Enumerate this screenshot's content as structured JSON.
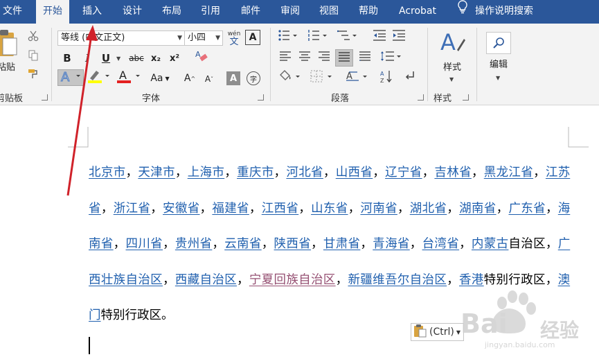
{
  "tabs": {
    "file": "文件",
    "home": "开始",
    "insert": "插入",
    "design": "设计",
    "layout": "布局",
    "references": "引用",
    "mailings": "邮件",
    "review": "审阅",
    "view": "视图",
    "help": "帮助",
    "acrobat": "Acrobat",
    "tell_me": "操作说明搜索"
  },
  "ribbon": {
    "clipboard": {
      "paste_label": "粘贴",
      "group_label": "剪贴板"
    },
    "font": {
      "font_name": "等线 (中文正文)",
      "font_size": "小四",
      "group_label": "字体",
      "bold": "B",
      "italic": "I",
      "underline": "U",
      "strike": "abc",
      "subscript": "x₂",
      "superscript": "x²",
      "font_color": "A",
      "change_case": "Aa",
      "grow": "A",
      "shrink": "A",
      "wen": "wén",
      "wen_char": "文",
      "border_char": "A",
      "shade_char": "A",
      "enclose_char": "字"
    },
    "paragraph": {
      "group_label": "段落"
    },
    "styles": {
      "label": "样式",
      "group_label": "样式"
    },
    "editing": {
      "label": "编辑"
    }
  },
  "document": {
    "paste_options": "(Ctrl)",
    "text_segments": [
      {
        "t": "北京市",
        "link": true
      },
      {
        "t": "，",
        "link": false
      },
      {
        "t": "天津市",
        "link": true
      },
      {
        "t": "，",
        "link": false
      },
      {
        "t": "上海市",
        "link": true
      },
      {
        "t": "，",
        "link": false
      },
      {
        "t": "重庆市",
        "link": true
      },
      {
        "t": "，",
        "link": false
      },
      {
        "t": "河北省",
        "link": true
      },
      {
        "t": "，",
        "link": false
      },
      {
        "t": "山西省",
        "link": true
      },
      {
        "t": "，",
        "link": false
      },
      {
        "t": "辽宁省",
        "link": true
      },
      {
        "t": "，",
        "link": false
      },
      {
        "t": "吉林省",
        "link": true
      },
      {
        "t": "，",
        "link": false
      },
      {
        "t": "黑龙江省",
        "link": true
      },
      {
        "t": "，",
        "link": false
      },
      {
        "t": "江苏省",
        "link": true
      },
      {
        "t": "，",
        "link": false
      },
      {
        "t": "浙江省",
        "link": true
      },
      {
        "t": "，",
        "link": false
      },
      {
        "t": "安徽省",
        "link": true
      },
      {
        "t": "，",
        "link": false
      },
      {
        "t": "福建省",
        "link": true
      },
      {
        "t": "，",
        "link": false
      },
      {
        "t": "江西省",
        "link": true
      },
      {
        "t": "，",
        "link": false
      },
      {
        "t": "山东省",
        "link": true
      },
      {
        "t": "，",
        "link": false
      },
      {
        "t": "河南省",
        "link": true
      },
      {
        "t": "，",
        "link": false
      },
      {
        "t": "湖北省",
        "link": true
      },
      {
        "t": "，",
        "link": false
      },
      {
        "t": "湖南省",
        "link": true
      },
      {
        "t": "，",
        "link": false
      },
      {
        "t": "广东省",
        "link": true
      },
      {
        "t": "，",
        "link": false
      },
      {
        "t": "海南省",
        "link": true
      },
      {
        "t": "，",
        "link": false
      },
      {
        "t": "四川省",
        "link": true
      },
      {
        "t": "，",
        "link": false
      },
      {
        "t": "贵州省",
        "link": true
      },
      {
        "t": "，",
        "link": false
      },
      {
        "t": "云南省",
        "link": true
      },
      {
        "t": "，",
        "link": false
      },
      {
        "t": "陕西省",
        "link": true
      },
      {
        "t": "，",
        "link": false
      },
      {
        "t": "甘肃省",
        "link": true
      },
      {
        "t": "，",
        "link": false
      },
      {
        "t": "青海省",
        "link": true
      },
      {
        "t": "，",
        "link": false
      },
      {
        "t": "台湾省",
        "link": true
      },
      {
        "t": "，",
        "link": false
      },
      {
        "t": "内蒙古",
        "link": true
      },
      {
        "t": "自治区，",
        "link": false
      },
      {
        "t": "广西壮族自治区",
        "link": true
      },
      {
        "t": "，",
        "link": false
      },
      {
        "t": "西藏自治区",
        "link": true
      },
      {
        "t": "，",
        "link": false
      },
      {
        "t": "宁夏回族自治区",
        "link": true,
        "visited": true
      },
      {
        "t": "，",
        "link": false
      },
      {
        "t": "新疆维吾尔自治区",
        "link": true
      },
      {
        "t": "，",
        "link": false
      },
      {
        "t": "香港",
        "link": true
      },
      {
        "t": "特别行政区，",
        "link": false
      },
      {
        "t": "澳门",
        "link": true
      },
      {
        "t": "特别行政区。",
        "link": false
      }
    ]
  },
  "watermark": {
    "brand": "Bai",
    "brand2": "经验",
    "url": "jingyan.baidu.com"
  },
  "colors": {
    "accent": "#2b579a",
    "link": "#1f5fae",
    "visited": "#954f72",
    "arrow": "#d0222a"
  }
}
